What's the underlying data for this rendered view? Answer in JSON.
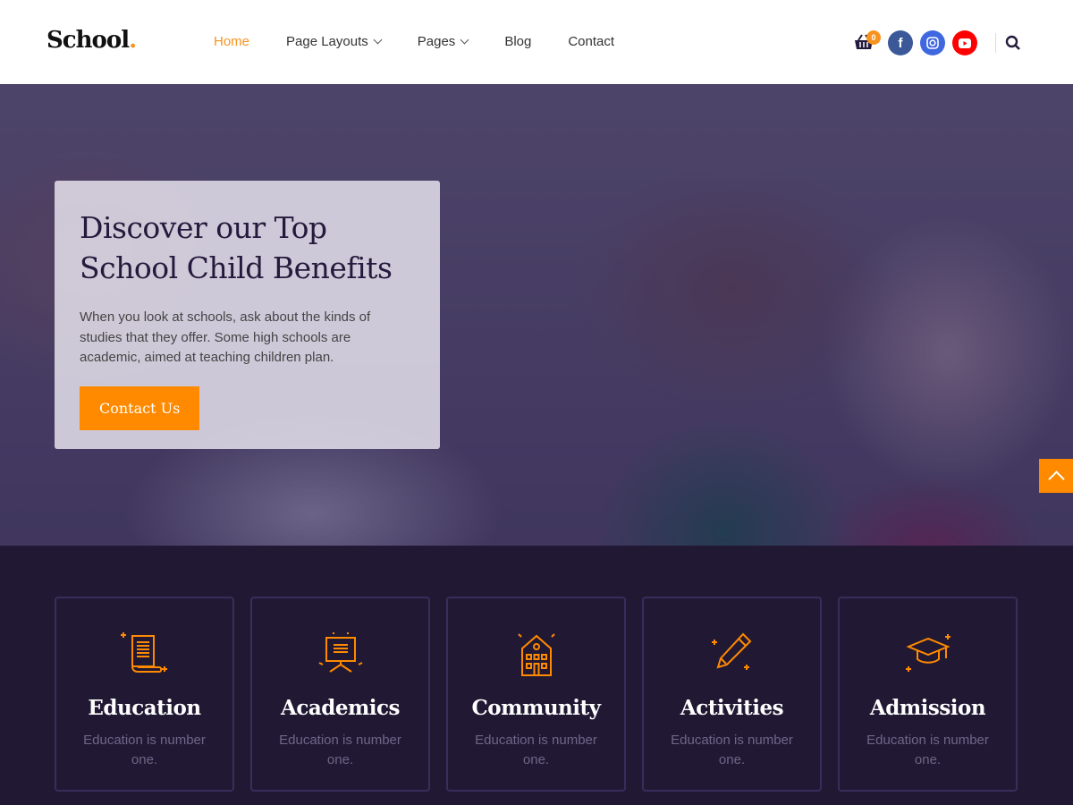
{
  "header": {
    "logo": "School",
    "logo_dot": ".",
    "nav": [
      {
        "label": "Home",
        "active": true
      },
      {
        "label": "Page Layouts",
        "dropdown": true
      },
      {
        "label": "Pages",
        "dropdown": true
      },
      {
        "label": "Blog"
      },
      {
        "label": "Contact"
      }
    ],
    "cart_count": "0",
    "social": [
      {
        "name": "facebook-icon",
        "glyph": "f",
        "color": "#3b5998"
      },
      {
        "name": "instagram-icon",
        "glyph": "◎",
        "color": "#3f67e0"
      },
      {
        "name": "youtube-icon",
        "glyph": "▶",
        "color": "#ff0000"
      }
    ]
  },
  "hero": {
    "title": "Discover our Top School Child Benefits",
    "text": "When you look at schools, ask about the kinds of studies that they offer. Some high schools are academic, aimed at teaching children plan.",
    "button": "Contact Us"
  },
  "features": [
    {
      "title": "Education",
      "text": "Education is number one.",
      "icon": "scroll-icon"
    },
    {
      "title": "Academics",
      "text": "Education is number one.",
      "icon": "presentation-board-icon"
    },
    {
      "title": "Community",
      "text": "Education is number one.",
      "icon": "school-building-icon"
    },
    {
      "title": "Activities",
      "text": "Education is number one.",
      "icon": "pencil-icon"
    },
    {
      "title": "Admission",
      "text": "Education is number one.",
      "icon": "graduation-cap-icon"
    }
  ],
  "colors": {
    "accent": "#ff8a00",
    "dark": "#211833"
  }
}
